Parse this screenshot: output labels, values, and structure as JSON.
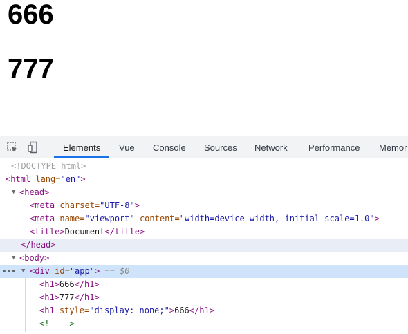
{
  "page": {
    "headings": [
      "666",
      "777"
    ]
  },
  "devtools": {
    "tabs": [
      "Elements",
      "Vue",
      "Console",
      "Sources",
      "Network",
      "Performance",
      "Memor"
    ],
    "active_tab": "Elements",
    "dom": {
      "doctype": "<!DOCTYPE html>",
      "html_open": {
        "tag": "<html",
        "attr": " lang=",
        "val": "\"en\"",
        "close": ">"
      },
      "head_open": "<head>",
      "meta_charset": {
        "tag": "<meta",
        "attr": " charset=",
        "val": "\"UTF-8\"",
        "close": ">"
      },
      "meta_viewport": {
        "tag": "<meta",
        "attr1": " name=",
        "val1": "\"viewport\"",
        "attr2": " content=",
        "val2": "\"width=device-width, initial-scale=1.0\"",
        "close": ">"
      },
      "title": {
        "open": "<title>",
        "text": "Document",
        "close": "</title>"
      },
      "head_close": "</head>",
      "body_open": "<body>",
      "div_app": {
        "tag": "<div",
        "attr": " id=",
        "val": "\"app\"",
        "close": ">",
        "marker": " == $0"
      },
      "h1_1": {
        "open": "<h1>",
        "text": "666",
        "close": "</h1>"
      },
      "h1_2": {
        "open": "<h1>",
        "text": "777",
        "close": "</h1>"
      },
      "h1_3": {
        "tag": "<h1",
        "attr": " style=",
        "val": "\"display: none;\"",
        "close": ">",
        "text": "666",
        "end": "</h1>"
      },
      "comment": "<!---->"
    }
  }
}
